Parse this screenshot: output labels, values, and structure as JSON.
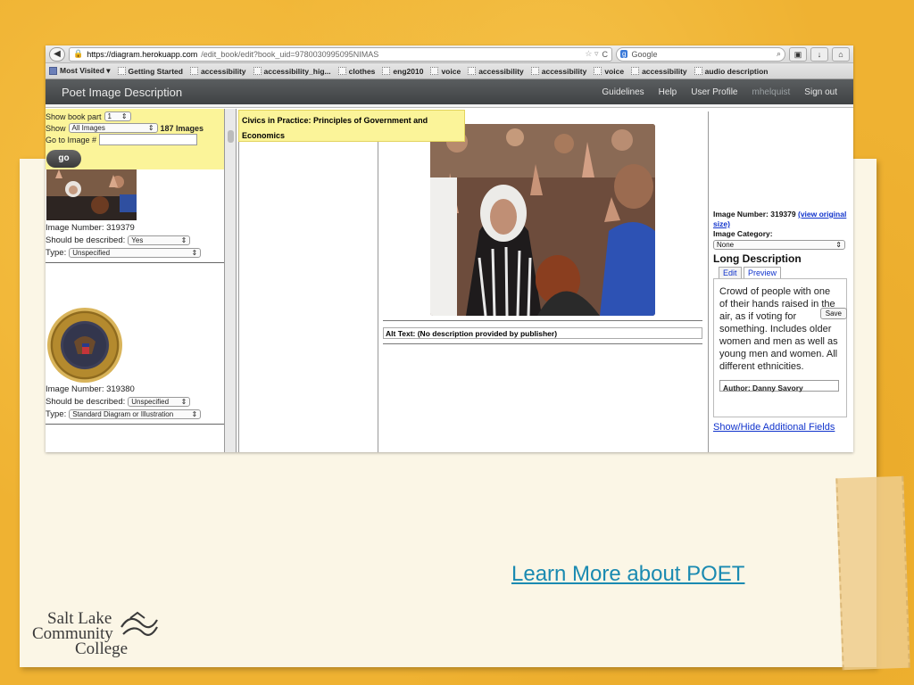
{
  "browser": {
    "url_domain": "https://diagram.herokuapp.com",
    "url_path": "/edit_book/edit?book_uid=9780030995095NIMAS",
    "search_placeholder": "Google",
    "bookmarks": [
      {
        "label": "Most Visited ▾",
        "folder": true
      },
      {
        "label": "Getting Started"
      },
      {
        "label": "accessibility"
      },
      {
        "label": "accessibility_hig..."
      },
      {
        "label": "clothes"
      },
      {
        "label": "eng2010"
      },
      {
        "label": "voice"
      },
      {
        "label": "accessibility"
      },
      {
        "label": "accessibility"
      },
      {
        "label": "voice"
      },
      {
        "label": "accessibility"
      },
      {
        "label": "audio description"
      }
    ]
  },
  "app": {
    "title": "Poet Image Description",
    "links": {
      "guidelines": "Guidelines",
      "help": "Help",
      "profile": "User Profile",
      "user": "mhelquist",
      "signout": "Sign out"
    }
  },
  "filters": {
    "show_book_part_label": "Show book part",
    "book_part_value": "1",
    "show_label": "Show",
    "show_value": "All Images",
    "image_count": "187 Images",
    "goto_label": "Go to Image #",
    "go_label": "go"
  },
  "left_items": [
    {
      "number_label": "Image Number: 319379",
      "described_label": "Should be described:",
      "described_value": "Yes",
      "type_label": "Type:",
      "type_value": "Unspecified"
    },
    {
      "number_label": "Image Number: 319380",
      "described_label": "Should be described:",
      "described_value": "Unspecified",
      "type_label": "Type:",
      "type_value": "Standard Diagram or Illustration"
    }
  ],
  "book_title": "Civics in Practice: Principles of Government and Economics",
  "alt_text": "Alt Text: (No description provided by publisher)",
  "right_panel": {
    "image_number": "Image Number: 319379",
    "view_link": "(view original size)",
    "category_label": "Image Category:",
    "category_value": "None",
    "long_desc_heading": "Long Description",
    "tab_edit": "Edit",
    "tab_preview": "Preview",
    "description": "Crowd of people with one of their hands raised in the air, as if voting for something. Includes older women and men as well as young men and women. All different ethnicities.",
    "author": "Author: Danny Savory",
    "toggle_fields": "Show/Hide Additional Fields",
    "save_label": "Save"
  },
  "slide": {
    "learn_more": "Learn More about POET",
    "logo_line1": "Salt Lake",
    "logo_line2": "Community",
    "logo_line3": "College"
  }
}
